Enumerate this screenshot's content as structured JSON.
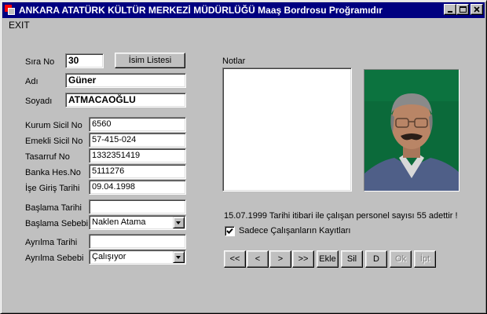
{
  "window": {
    "title": "ANKARA ATATÜRK KÜLTÜR MERKEZİ MÜDÜRLÜĞÜ Maaş Bordrosu Proğramıdır",
    "controls": {
      "minimize_icon": "minimize-icon",
      "maximize_icon": "maximize-icon",
      "close_icon": "close-icon"
    }
  },
  "menu": {
    "exit": "EXIT"
  },
  "form": {
    "sira_no": {
      "label": "Sıra No",
      "value": "30"
    },
    "isim_listesi_button": "İsim Listesi",
    "adi": {
      "label": "Adı",
      "value": "Güner"
    },
    "soyadi": {
      "label": "Soyadı",
      "value": "ATMACAOĞLU"
    },
    "kurum_sicil_no": {
      "label": "Kurum Sicil No",
      "value": "6560"
    },
    "emekli_sicil_no": {
      "label": "Emekli Sicil No",
      "value": "57-415-024"
    },
    "tasarruf_no": {
      "label": "Tasarruf No",
      "value": "1332351419"
    },
    "banka_hes_no": {
      "label": "Banka Hes.No",
      "value": "5111276"
    },
    "ise_giris_tarihi": {
      "label": "İşe Giriş Tarihi",
      "value": "09.04.1998"
    },
    "baslama_tarihi": {
      "label": "Başlama Tarihi",
      "value": ""
    },
    "baslama_sebebi": {
      "label": "Başlama Sebebi",
      "value": "Naklen Atama"
    },
    "ayrilma_tarihi": {
      "label": "Ayrılma Tarihi",
      "value": ""
    },
    "ayrilma_sebebi": {
      "label": "Ayrılma Sebebi",
      "value": "Çalışıyor"
    }
  },
  "notes": {
    "label": "Notlar",
    "value": ""
  },
  "status": {
    "message": "15.07.1999 Tarihi itibari ile çalışan personel sayısı 55 adettir !",
    "checkbox_label": "Sadece Çalışanların Kayıtları",
    "checkbox_checked": true
  },
  "nav_buttons": {
    "first": "<<",
    "prev": "<",
    "next": ">",
    "last": ">>",
    "add": "Ekle",
    "delete": "Sil",
    "edit": "D",
    "ok": "Ok",
    "cancel": "İpt"
  },
  "colors": {
    "titlebar": "#000080",
    "face": "#c0c0c0",
    "photo_bg": "#0b6a3a"
  }
}
